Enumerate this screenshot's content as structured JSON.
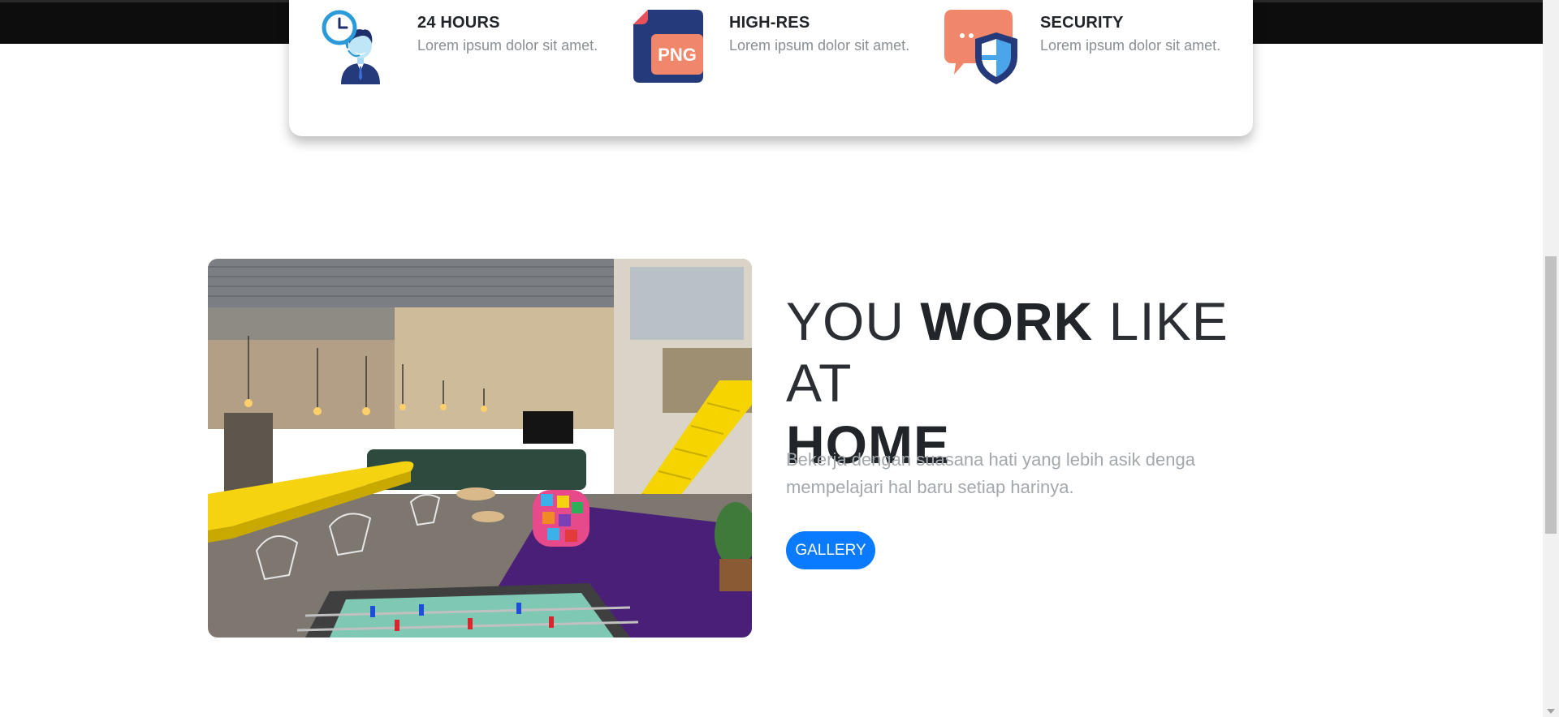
{
  "features": [
    {
      "title": "24 HOURS",
      "description": "Lorem ipsum dolor sit amet.",
      "icon": "support-agent-clock-icon"
    },
    {
      "title": "HIGH-RES",
      "description": "Lorem ipsum dolor sit amet.",
      "icon": "png-file-icon",
      "icon_text": "PNG"
    },
    {
      "title": "SECURITY",
      "description": "Lorem ipsum dolor sit amet.",
      "icon": "chat-shield-icon"
    }
  ],
  "about": {
    "heading_part1": "YOU ",
    "heading_bold1": "WORK",
    "heading_part2": " LIKE AT ",
    "heading_bold2": "HOME",
    "lead": "Bekerja dengan suasana hati yang lebih asik denga mempelajari hal baru setiap harinya.",
    "button_label": "GALLERY",
    "photo": "coworking-lounge-photo"
  },
  "colors": {
    "accent": "#0a7bff",
    "heading": "#212529",
    "muted": "#a3a8ad"
  }
}
